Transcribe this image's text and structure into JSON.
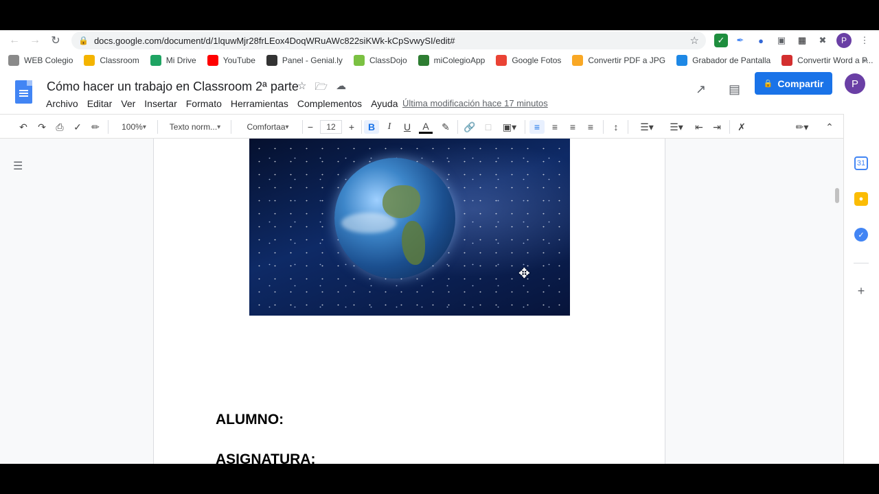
{
  "browser": {
    "url": "docs.google.com/document/d/1lquwMjr28frLEox4DoqWRuAWc822siKWk-kCpSvwySI/edit#",
    "profile_initial": "P"
  },
  "bookmarks": [
    {
      "label": "WEB Colegio",
      "icon": "asterisk-icon",
      "color": "#8a8a8a"
    },
    {
      "label": "Classroom",
      "icon": "classroom-icon",
      "color": "#f4b400"
    },
    {
      "label": "Mi Drive",
      "icon": "drive-icon",
      "color": "#1fa463"
    },
    {
      "label": "YouTube",
      "icon": "youtube-icon",
      "color": "#ff0000"
    },
    {
      "label": "Panel - Genial.ly",
      "icon": "genially-icon",
      "color": "#333333"
    },
    {
      "label": "ClassDojo",
      "icon": "classdojo-icon",
      "color": "#7bc142"
    },
    {
      "label": "miColegioApp",
      "icon": "micolegio-icon",
      "color": "#2e7d32"
    },
    {
      "label": "Google Fotos",
      "icon": "photos-icon",
      "color": "#ea4335"
    },
    {
      "label": "Convertir PDF a JPG",
      "icon": "pdf-jpg-icon",
      "color": "#f9a825"
    },
    {
      "label": "Grabador de Pantalla",
      "icon": "recorder-icon",
      "color": "#1e88e5"
    },
    {
      "label": "Convertir Word a P...",
      "icon": "heart-icon",
      "color": "#d32f2f"
    }
  ],
  "bookmarks_more": "»",
  "doc": {
    "title": "Cómo hacer un trabajo en Classroom 2ª parte",
    "menus": [
      "Archivo",
      "Editar",
      "Ver",
      "Insertar",
      "Formato",
      "Herramientas",
      "Complementos",
      "Ayuda"
    ],
    "last_edit": "Última modificación hace 17 minutos",
    "share_label": "Compartir",
    "avatar_initial": "P"
  },
  "toolbar": {
    "zoom": "100%",
    "style": "Texto norm...",
    "font": "Comfortaa",
    "font_size": "12",
    "bold": "B",
    "italic": "I",
    "underline": "U",
    "text_color": "A"
  },
  "content": {
    "label_alumno": "ALUMNO:",
    "label_asignatura": "ASIGNATURA:"
  },
  "colors": {
    "accent": "#1a73e8",
    "avatar": "#6a3fa5"
  }
}
